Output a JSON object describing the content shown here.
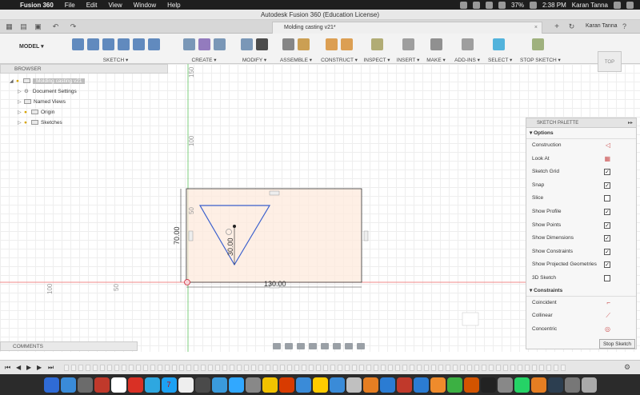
{
  "menubar": {
    "app_name": "Fusion 360",
    "items": [
      "File",
      "Edit",
      "View",
      "Window",
      "Help"
    ],
    "battery": "37%",
    "time": "2:38 PM",
    "user": "Karan Tanna"
  },
  "window": {
    "title": "Autodesk Fusion 360 (Education License)"
  },
  "tabbar": {
    "document_tab": "Molding casting v21*",
    "user": "Karan Tanna"
  },
  "toolbar": {
    "workspace": "MODEL ▾",
    "groups": [
      {
        "label": "SKETCH ▾",
        "colors": [
          "#3c6fb0",
          "#3c6fb0",
          "#3c6fb0",
          "#3c6fb0",
          "#3c6fb0",
          "#3c6fb0"
        ]
      },
      {
        "label": "CREATE ▾",
        "colors": [
          "#5b7fa8",
          "#7a5cb0",
          "#5b7fa8"
        ]
      },
      {
        "label": "MODIFY ▾",
        "colors": [
          "#5b7fa8",
          "#222222"
        ]
      },
      {
        "label": "ASSEMBLE ▾",
        "colors": [
          "#6a6a6a",
          "#c08a2a"
        ]
      },
      {
        "label": "CONSTRUCT ▾",
        "colors": [
          "#d68a2a",
          "#d68a2a"
        ]
      },
      {
        "label": "INSPECT ▾",
        "colors": [
          "#a09a55"
        ]
      },
      {
        "label": "INSERT ▾",
        "colors": [
          "#888888"
        ]
      },
      {
        "label": "MAKE ▾",
        "colors": [
          "#777777"
        ]
      },
      {
        "label": "ADD-INS ▾",
        "colors": [
          "#888888"
        ]
      },
      {
        "label": "SELECT ▾",
        "colors": [
          "#29a3d6"
        ]
      },
      {
        "label": "STOP SKETCH ▾",
        "colors": [
          "#8aa060"
        ]
      }
    ]
  },
  "browser": {
    "title": "BROWSER",
    "root": "Molding casting v21",
    "items": [
      "Document Settings",
      "Named Views",
      "Origin",
      "Sketches"
    ]
  },
  "canvas": {
    "ruler_marks": [
      "150",
      "100",
      "50",
      "100",
      "50"
    ],
    "dim_height": "70.00",
    "dim_width": "130.00",
    "dim_triangle": "30.00"
  },
  "viewcube": {
    "label": "TOP"
  },
  "palette": {
    "title": "SKETCH PALETTE",
    "options_title": "Options",
    "options": [
      {
        "label": "Construction",
        "control": "sym",
        "value": "◁"
      },
      {
        "label": "Look At",
        "control": "sym",
        "value": "▦"
      },
      {
        "label": "Sketch Grid",
        "control": "check",
        "value": "✓"
      },
      {
        "label": "Snap",
        "control": "check",
        "value": "✓"
      },
      {
        "label": "Slice",
        "control": "check",
        "value": ""
      },
      {
        "label": "Show Profile",
        "control": "check",
        "value": "✓"
      },
      {
        "label": "Show Points",
        "control": "check",
        "value": "✓"
      },
      {
        "label": "Show Dimensions",
        "control": "check",
        "value": "✓"
      },
      {
        "label": "Show Constraints",
        "control": "check",
        "value": "✓"
      },
      {
        "label": "Show Projected Geometries",
        "control": "check",
        "value": "✓"
      },
      {
        "label": "3D Sketch",
        "control": "check",
        "value": ""
      }
    ],
    "constraints_title": "Constraints",
    "constraints": [
      {
        "label": "Coincident",
        "control": "sym",
        "value": "⌐"
      },
      {
        "label": "Collinear",
        "control": "sym",
        "value": "⟋"
      },
      {
        "label": "Concentric",
        "control": "sym",
        "value": "◎"
      }
    ],
    "stop_button": "Stop Sketch"
  },
  "comments": {
    "title": "COMMENTS"
  },
  "dock": {
    "calendar_day": "7",
    "colors": [
      "#2f6bd6",
      "#3a8bd8",
      "#6b6b6b",
      "#c0392b",
      "#ffffff",
      "#d93025",
      "#2ea7e0",
      "#1da1f2",
      "#eeeeee",
      "#4a4a4a",
      "#3a9bdc",
      "#31a8ff",
      "#888888",
      "#f2c200",
      "#d83b01",
      "#3a8bd8",
      "#ffcc00",
      "#3a8bd8",
      "#c0c0c0",
      "#e67e22",
      "#2b7cd3",
      "#c0392b",
      "#2b7cd3",
      "#ef8b2c",
      "#3cb043",
      "#d35400",
      "#222222",
      "#888888",
      "#25d366",
      "#e67e22",
      "#2c3e50",
      "#777777",
      "#aaaaaa"
    ]
  }
}
